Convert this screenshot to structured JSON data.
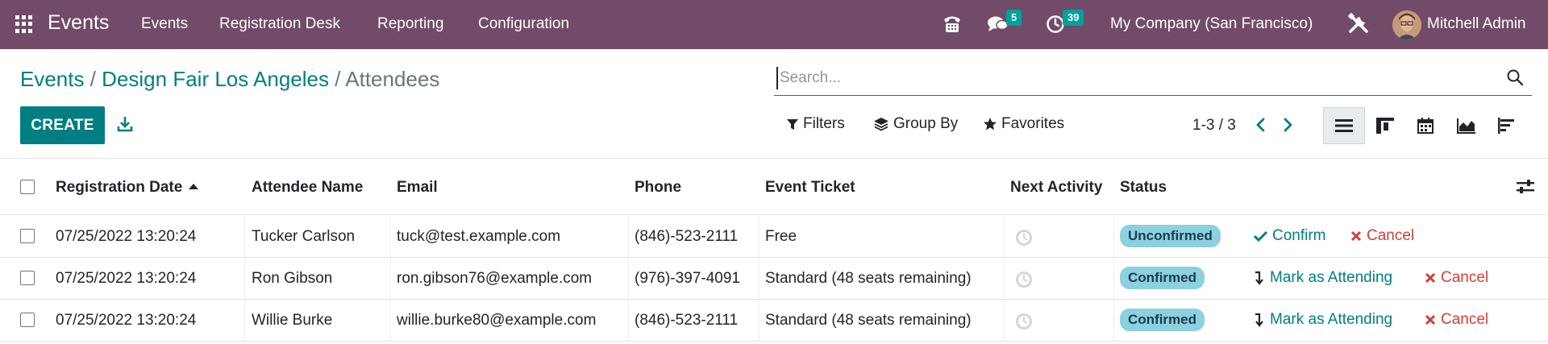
{
  "navbar": {
    "app_name": "Events",
    "menu": [
      "Events",
      "Registration Desk",
      "Reporting",
      "Configuration"
    ],
    "messages_count": "5",
    "activities_count": "39",
    "company": "My Company (San Francisco)",
    "user": "Mitchell Admin"
  },
  "breadcrumb": {
    "root": "Events",
    "separator": " / ",
    "parent": "Design Fair Los Angeles",
    "current": "Attendees"
  },
  "search": {
    "placeholder": "Search..."
  },
  "toolbar": {
    "create_label": "CREATE",
    "filters_label": "Filters",
    "group_by_label": "Group By",
    "favorites_label": "Favorites",
    "pager": "1-3 / 3"
  },
  "table": {
    "headers": {
      "registration_date": "Registration Date",
      "attendee_name": "Attendee Name",
      "email": "Email",
      "phone": "Phone",
      "event_ticket": "Event Ticket",
      "next_activity": "Next Activity",
      "status": "Status"
    },
    "rows": [
      {
        "registration_date": "07/25/2022 13:20:24",
        "attendee_name": "Tucker Carlson",
        "email": "tuck@test.example.com",
        "phone": "(846)-523-2111",
        "event_ticket": "Free",
        "status": "Unconfirmed",
        "action_primary": "Confirm",
        "action_cancel": "Cancel"
      },
      {
        "registration_date": "07/25/2022 13:20:24",
        "attendee_name": "Ron Gibson",
        "email": "ron.gibson76@example.com",
        "phone": "(976)-397-4091",
        "event_ticket": "Standard (48 seats remaining)",
        "status": "Confirmed",
        "action_primary": "Mark as Attending",
        "action_cancel": "Cancel"
      },
      {
        "registration_date": "07/25/2022 13:20:24",
        "attendee_name": "Willie Burke",
        "email": "willie.burke80@example.com",
        "phone": "(846)-523-2111",
        "event_ticket": "Standard (48 seats remaining)",
        "status": "Confirmed",
        "action_primary": "Mark as Attending",
        "action_cancel": "Cancel"
      }
    ]
  },
  "colors": {
    "navbar": "#714B67",
    "primary": "#017e84",
    "badge_teal": "#00A09D",
    "status_badge": "#8bd1df",
    "cancel_red": "#d23f3a"
  },
  "icons": [
    "apps-grid-icon",
    "phone-icon",
    "chat-icon",
    "clock-icon",
    "tools-icon",
    "search-icon",
    "download-icon",
    "filter-icon",
    "layers-icon",
    "star-icon",
    "chevron-left-icon",
    "chevron-right-icon",
    "list-view-icon",
    "kanban-view-icon",
    "calendar-view-icon",
    "graph-view-icon",
    "activity-view-icon",
    "optional-columns-icon",
    "clock-activity-icon",
    "check-icon",
    "times-icon",
    "level-down-icon"
  ]
}
